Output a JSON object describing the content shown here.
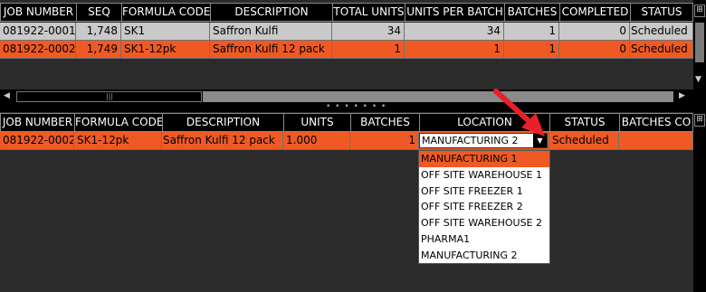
{
  "top_grid": {
    "headers": [
      "JOB NUMBER",
      "SEQ",
      "FORMULA CODE",
      "DESCRIPTION",
      "TOTAL UNITS",
      "UNITS PER BATCH",
      "BATCHES",
      "COMPLETED",
      "STATUS"
    ],
    "rows": [
      {
        "job": "081922-0001",
        "seq": "1,748",
        "formula": "SK1",
        "desc": "Saffron Kulfi",
        "total": "34",
        "upb": "34",
        "batches": "1",
        "completed": "0",
        "status": "Scheduled"
      },
      {
        "job": "081922-0002",
        "seq": "1,749",
        "formula": "SK1-12pk",
        "desc": "Saffron Kulfi 12 pack",
        "total": "1",
        "upb": "1",
        "batches": "1",
        "completed": "0",
        "status": "Scheduled"
      }
    ]
  },
  "bottom_grid": {
    "headers": [
      "JOB NUMBER",
      "FORMULA CODE",
      "DESCRIPTION",
      "UNITS",
      "BATCHES",
      "LOCATION",
      "STATUS",
      "BATCHES CO"
    ],
    "row": {
      "job": "081922-0002",
      "formula": "SK1-12pk",
      "desc": "Saffron Kulfi 12 pack",
      "units": "1.000",
      "batches": "1",
      "location": "MANUFACTURING 2",
      "status": "Scheduled",
      "batches_co": ""
    }
  },
  "location_dropdown": {
    "options": [
      "MANUFACTURING 1",
      "OFF SITE WAREHOUSE 1",
      "OFF SITE FREEZER 1",
      "OFF SITE FREEZER 2",
      "OFF SITE WAREHOUSE 2",
      "PHARMA1",
      "MANUFACTURING 2"
    ],
    "highlighted_index": 0
  },
  "colors": {
    "accent": "#ef5a24",
    "row_gray": "#c9c9c9",
    "grid_bg": "#2b2b2b",
    "arrow": "#e8202a"
  },
  "icons": {
    "column_chooser": "column-chooser-icon",
    "dropdown": "chevron-down-icon"
  }
}
